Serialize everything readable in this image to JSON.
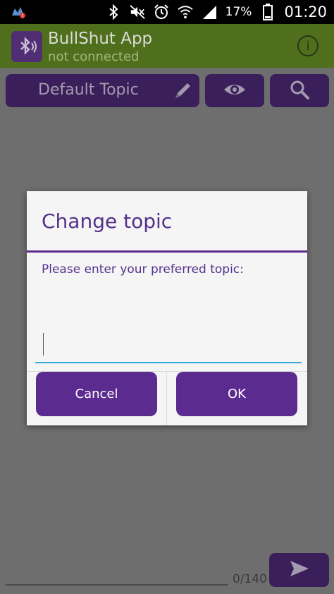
{
  "status_bar": {
    "battery": "17%",
    "time": "01:20",
    "icons": [
      "app-notification-icon",
      "bluetooth-icon",
      "mute-icon",
      "alarm-icon",
      "wifi-icon",
      "signal-icon",
      "battery-icon"
    ]
  },
  "app_bar": {
    "title": "BullShut App",
    "subtitle": "not connected",
    "icons": [
      "bluetooth-logo-icon",
      "info-icon"
    ]
  },
  "toolbar": {
    "topic_label": "Default Topic",
    "icons": [
      "pencil-icon",
      "eye-icon",
      "search-icon"
    ]
  },
  "compose": {
    "counter": "0/140",
    "icons": [
      "send-icon"
    ]
  },
  "dialog": {
    "title": "Change topic",
    "message": "Please enter your preferred topic:",
    "input_value": "",
    "cancel_label": "Cancel",
    "ok_label": "OK"
  },
  "colors": {
    "app_bar": "#4f6f1d",
    "toolbar_button": "#3a1f5b",
    "dialog_accent": "#5a2d8c",
    "dialog_button": "#5b2b8f",
    "input_underline": "#3aa8d8"
  }
}
